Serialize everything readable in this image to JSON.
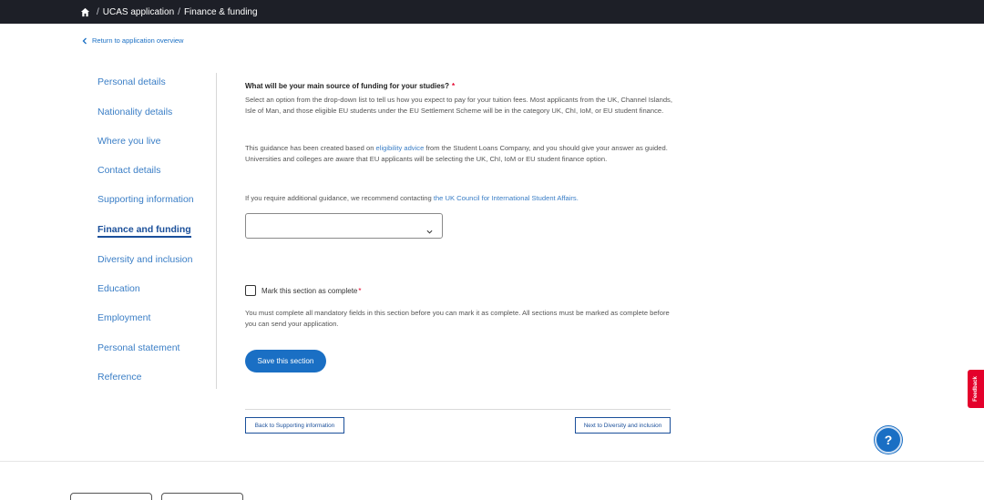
{
  "breadcrumb": {
    "home_icon": "home-icon",
    "items": [
      "UCAS application",
      "Finance & funding"
    ],
    "separator": "/"
  },
  "return_link": {
    "label": "Return to application overview",
    "icon": "chevron-left-icon"
  },
  "sidebar": {
    "items": [
      {
        "label": "Personal details",
        "active": false
      },
      {
        "label": "Nationality details",
        "active": false
      },
      {
        "label": "Where you live",
        "active": false
      },
      {
        "label": "Contact details",
        "active": false
      },
      {
        "label": "Supporting information",
        "active": false
      },
      {
        "label": "Finance and funding",
        "active": true
      },
      {
        "label": "Diversity and inclusion",
        "active": false
      },
      {
        "label": "Education",
        "active": false
      },
      {
        "label": "Employment",
        "active": false
      },
      {
        "label": "Personal statement",
        "active": false
      },
      {
        "label": "Reference",
        "active": false
      }
    ]
  },
  "main": {
    "question": "What will be your main source of funding for your studies?",
    "required_marker": "*",
    "para1": "Select an option from the drop-down list to tell us how you expect to pay for your tuition fees. Most applicants from the UK, Channel Islands, Isle of Man, and those eligible EU students under the EU Settlement Scheme will be in the category UK, ChI, IoM, or EU student finance.",
    "para2_before": "This guidance has been created based on ",
    "para2_link": "eligibility advice",
    "para2_after": " from the Student Loans Company, and you should give your answer as guided. Universities and colleges are aware that EU applicants will be selecting the UK, ChI, IoM or EU student finance option.",
    "para3_before": "If you require additional guidance, we recommend contacting ",
    "para3_link": "the UK Council for International Student Affairs.",
    "select_value": "",
    "select_icon": "chevron-down-icon",
    "checkbox_label": "Mark this section as complete",
    "checkbox_checked": false,
    "complete_note": "You must complete all mandatory fields in this section before you can mark it as complete. All sections must be marked as complete before you can send your application.",
    "save_button": "Save this section"
  },
  "pager": {
    "back_label": "Back to Supporting information",
    "next_label": "Next to Diversity and inclusion"
  },
  "help_button": "?",
  "feedback_tab": "Feedback",
  "colors": {
    "topbar": "#1d1f27",
    "link": "#3a7ec6",
    "primary": "#1a6fc4",
    "required": "#e4002b"
  }
}
